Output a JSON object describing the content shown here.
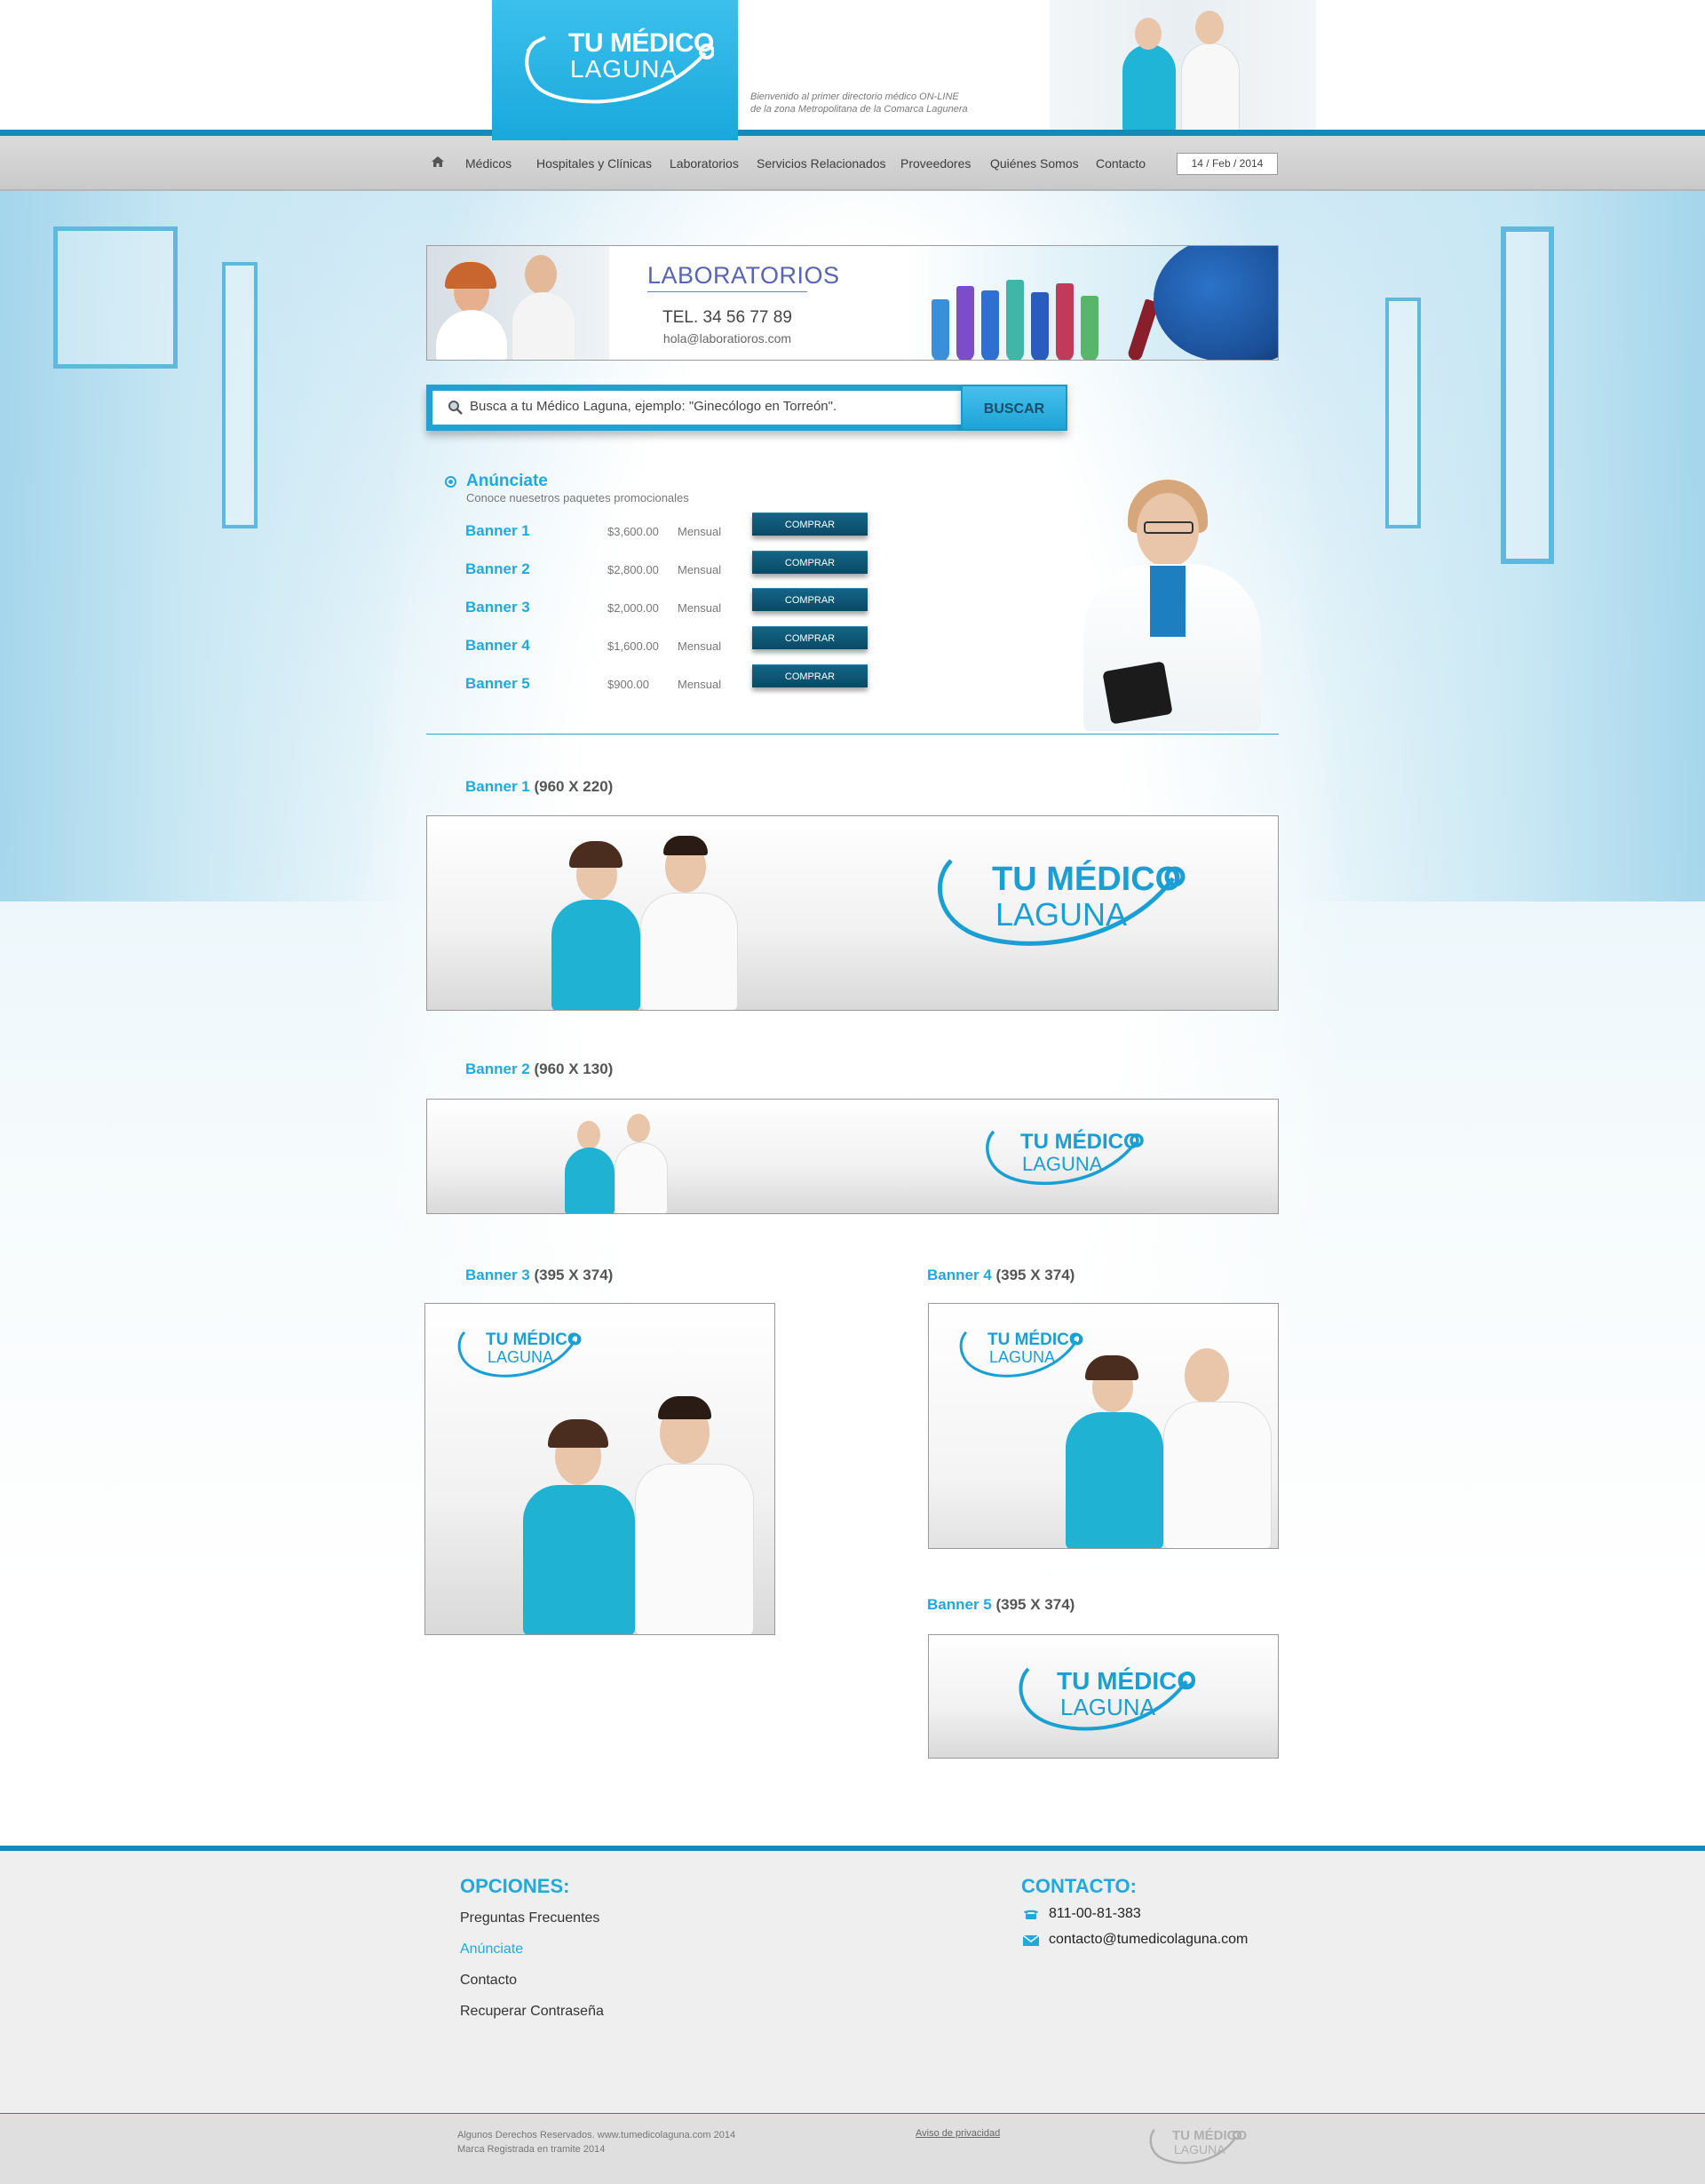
{
  "brand": {
    "name_line1": "TU MÉDICO",
    "name_line2": "LAGUNA",
    "tagline_line1": "Bienvenido al primer directorio médico ON-LINE",
    "tagline_line2": "de la zona Metropolitana de la Comarca Lagunera"
  },
  "nav": {
    "items": [
      "Médicos",
      "Hospitales y Clínicas",
      "Laboratorios",
      "Servicios Relacionados",
      "Proveedores",
      "Quiénes Somos",
      "Contacto"
    ],
    "date": "14 / Feb / 2014"
  },
  "lab_banner": {
    "title": "LABORATORIOS",
    "tel": "TEL. 34 56 77 89",
    "email": "hola@laboratioros.com"
  },
  "search": {
    "placeholder": "Busca a tu Médico Laguna, ejemplo: \"Ginecólogo en Torreón\".",
    "button": "BUSCAR"
  },
  "anunciate": {
    "title": "Anúnciate",
    "subtitle": "Conoce nuesetros paquetes promocionales",
    "packages": [
      {
        "name": "Banner 1",
        "price": "$3,600.00",
        "period": "Mensual",
        "button": "COMPRAR"
      },
      {
        "name": "Banner 2",
        "price": "$2,800.00",
        "period": "Mensual",
        "button": "COMPRAR"
      },
      {
        "name": "Banner 3",
        "price": "$2,000.00",
        "period": "Mensual",
        "button": "COMPRAR"
      },
      {
        "name": "Banner 4",
        "price": "$1,600.00",
        "period": "Mensual",
        "button": "COMPRAR"
      },
      {
        "name": "Banner 5",
        "price": "$900.00",
        "period": "Mensual",
        "button": "COMPRAR"
      }
    ]
  },
  "samples": [
    {
      "name": "Banner 1",
      "dims": "(960 X 220)"
    },
    {
      "name": "Banner 2",
      "dims": "(960 X 130)"
    },
    {
      "name": "Banner 3",
      "dims": "(395 X 374)"
    },
    {
      "name": "Banner 4",
      "dims": "(395 X 374)"
    },
    {
      "name": "Banner 5",
      "dims": "(395 X 374)"
    }
  ],
  "footer": {
    "options_title": "OPCIONES:",
    "options": [
      "Preguntas Frecuentes",
      "Anúnciate",
      "Contacto",
      "Recuperar Contraseña"
    ],
    "contact_title": "CONTACTO:",
    "phone": "811-00-81-383",
    "email": "contacto@tumedicolaguna.com",
    "copyright_line1": "Algunos Derechos Reservados. www.tumedicolaguna.com 2014",
    "copyright_line2": "Marca Registrada en tramite 2014",
    "privacy": "Aviso de privacidad"
  },
  "colors": {
    "accent": "#22a9dc",
    "nav_line": "#168ab7",
    "button_dark": "#0a4966"
  }
}
